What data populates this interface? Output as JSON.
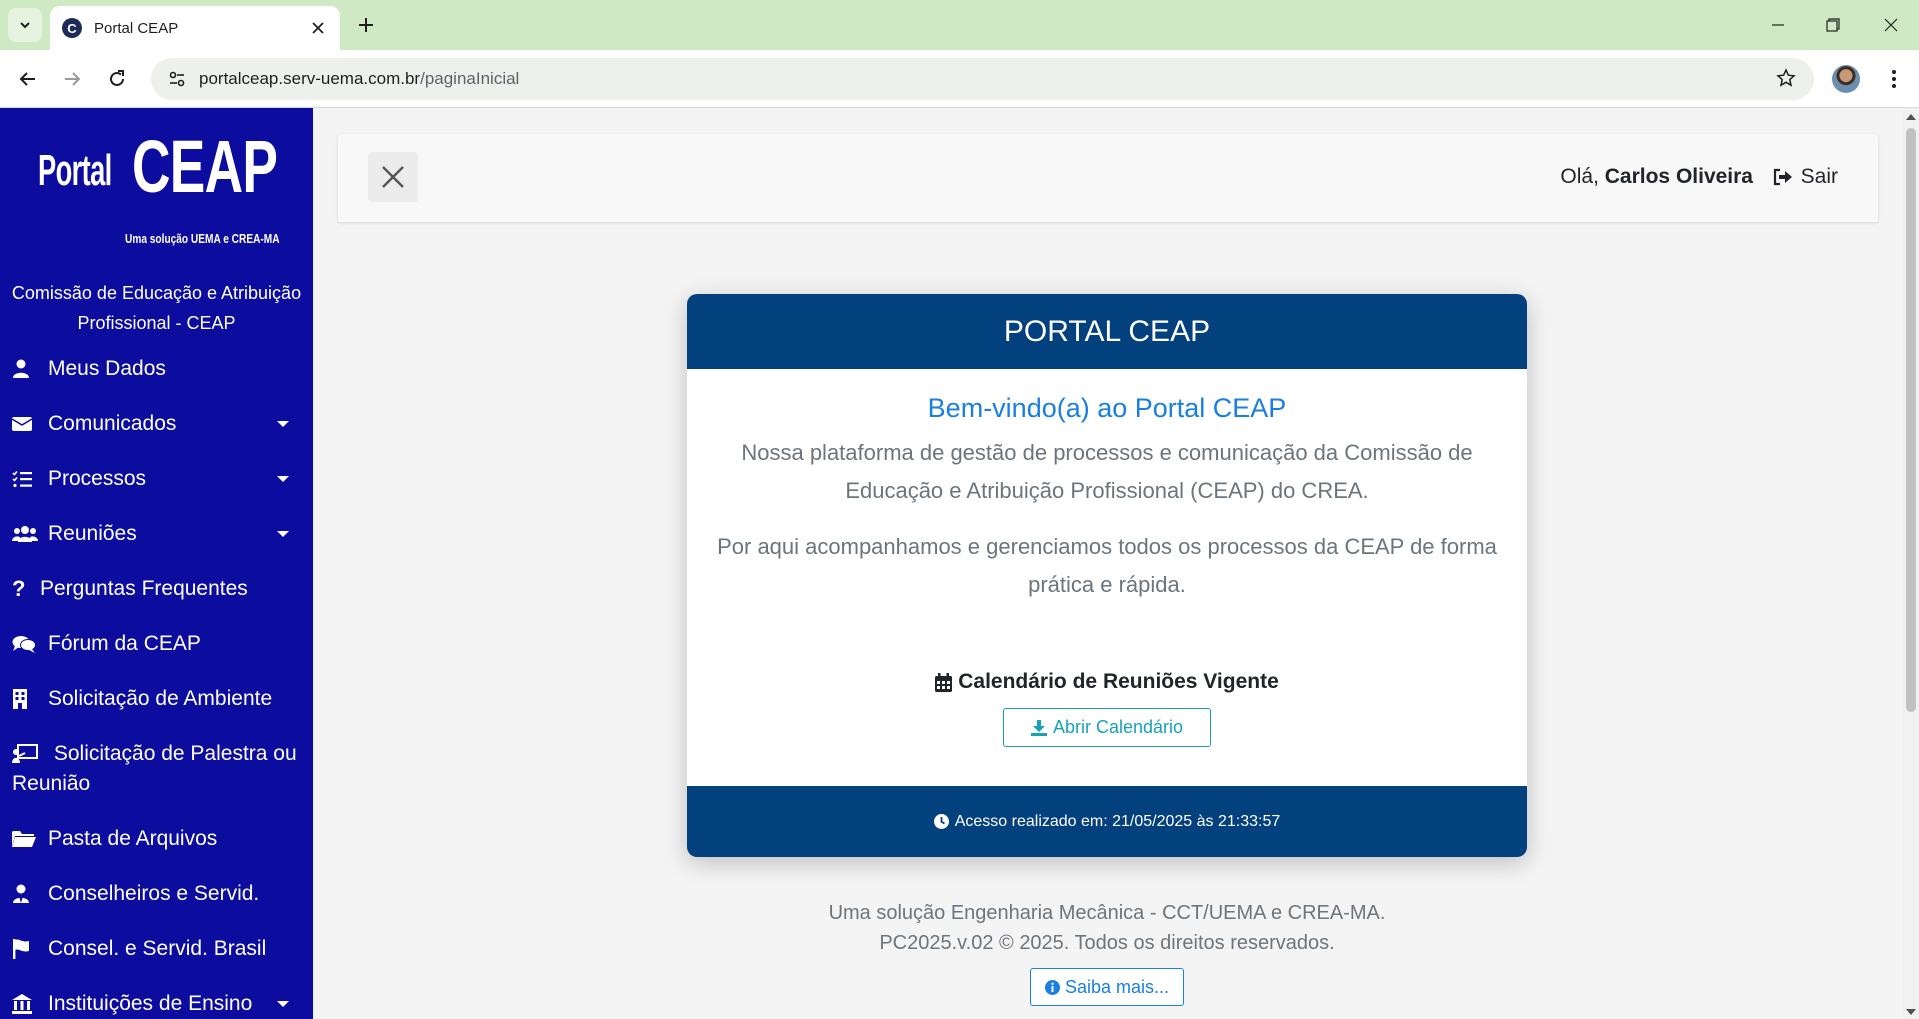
{
  "browser": {
    "tab_title": "Portal CEAP",
    "tab_favicon_letter": "C",
    "url_host": "portalceap.serv-uema.com.br",
    "url_path": "/paginaInicial"
  },
  "sidebar": {
    "logo_portal": "Portal",
    "logo_ceap": "CEAP",
    "logo_sub": "Uma solução UEMA e CREA-MA",
    "org_name": "Comissão de Educação e Atribuição Profissional - CEAP",
    "items": [
      {
        "label": "Meus Dados",
        "icon": "user-icon",
        "caret": false
      },
      {
        "label": "Comunicados",
        "icon": "envelope-icon",
        "caret": true
      },
      {
        "label": "Processos",
        "icon": "list-icon",
        "caret": true
      },
      {
        "label": "Reuniões",
        "icon": "users-icon",
        "caret": true
      },
      {
        "label": "Perguntas Frequentes",
        "icon": "question-icon",
        "caret": false
      },
      {
        "label": "Fórum da CEAP",
        "icon": "comments-icon",
        "caret": false
      },
      {
        "label": "Solicitação de Ambiente",
        "icon": "building-icon",
        "caret": false
      },
      {
        "label": "Solicitação de Palestra ou Reunião",
        "icon": "presentation-icon",
        "caret": false
      },
      {
        "label": "Pasta de Arquivos",
        "icon": "folder-open-icon",
        "caret": false
      },
      {
        "label": "Conselheiros e Servid.",
        "icon": "user-tie-icon",
        "caret": false
      },
      {
        "label": "Consel. e Servid. Brasil",
        "icon": "flag-icon",
        "caret": false
      },
      {
        "label": "Instituições de Ensino",
        "icon": "university-icon",
        "caret": true
      }
    ]
  },
  "header": {
    "greeting_prefix": "Olá,",
    "user_name": "Carlos Oliveira",
    "logout_label": "Sair"
  },
  "card": {
    "header": "PORTAL CEAP",
    "title": "Bem-vindo(a) ao Portal CEAP",
    "paragraph1": "Nossa plataforma de gestão de processos e comunicação da Comissão de Educação e Atribuição Profissional (CEAP) do CREA.",
    "paragraph2": "Por aqui acompanhamos e gerenciamos todos os processos da CEAP de forma prática e rápida.",
    "calendar_title": "Calendário de Reuniões Vigente",
    "calendar_button": "Abrir Calendário",
    "footer": "Acesso realizado em: 21/05/2025 às 21:33:57"
  },
  "footer": {
    "line1": "Uma solução Engenharia Mecânica - CCT/UEMA e CREA-MA.",
    "line2": "PC2025.v.02 © 2025. Todos os direitos reservados.",
    "more_button": "Saiba mais..."
  },
  "colors": {
    "sidebar_bg": "#0c0c9e",
    "card_header_bg": "#03407e",
    "accent_blue": "#1a7fe0",
    "accent_teal": "#17a2b8",
    "tabbar_bg": "#cfe9c4"
  }
}
